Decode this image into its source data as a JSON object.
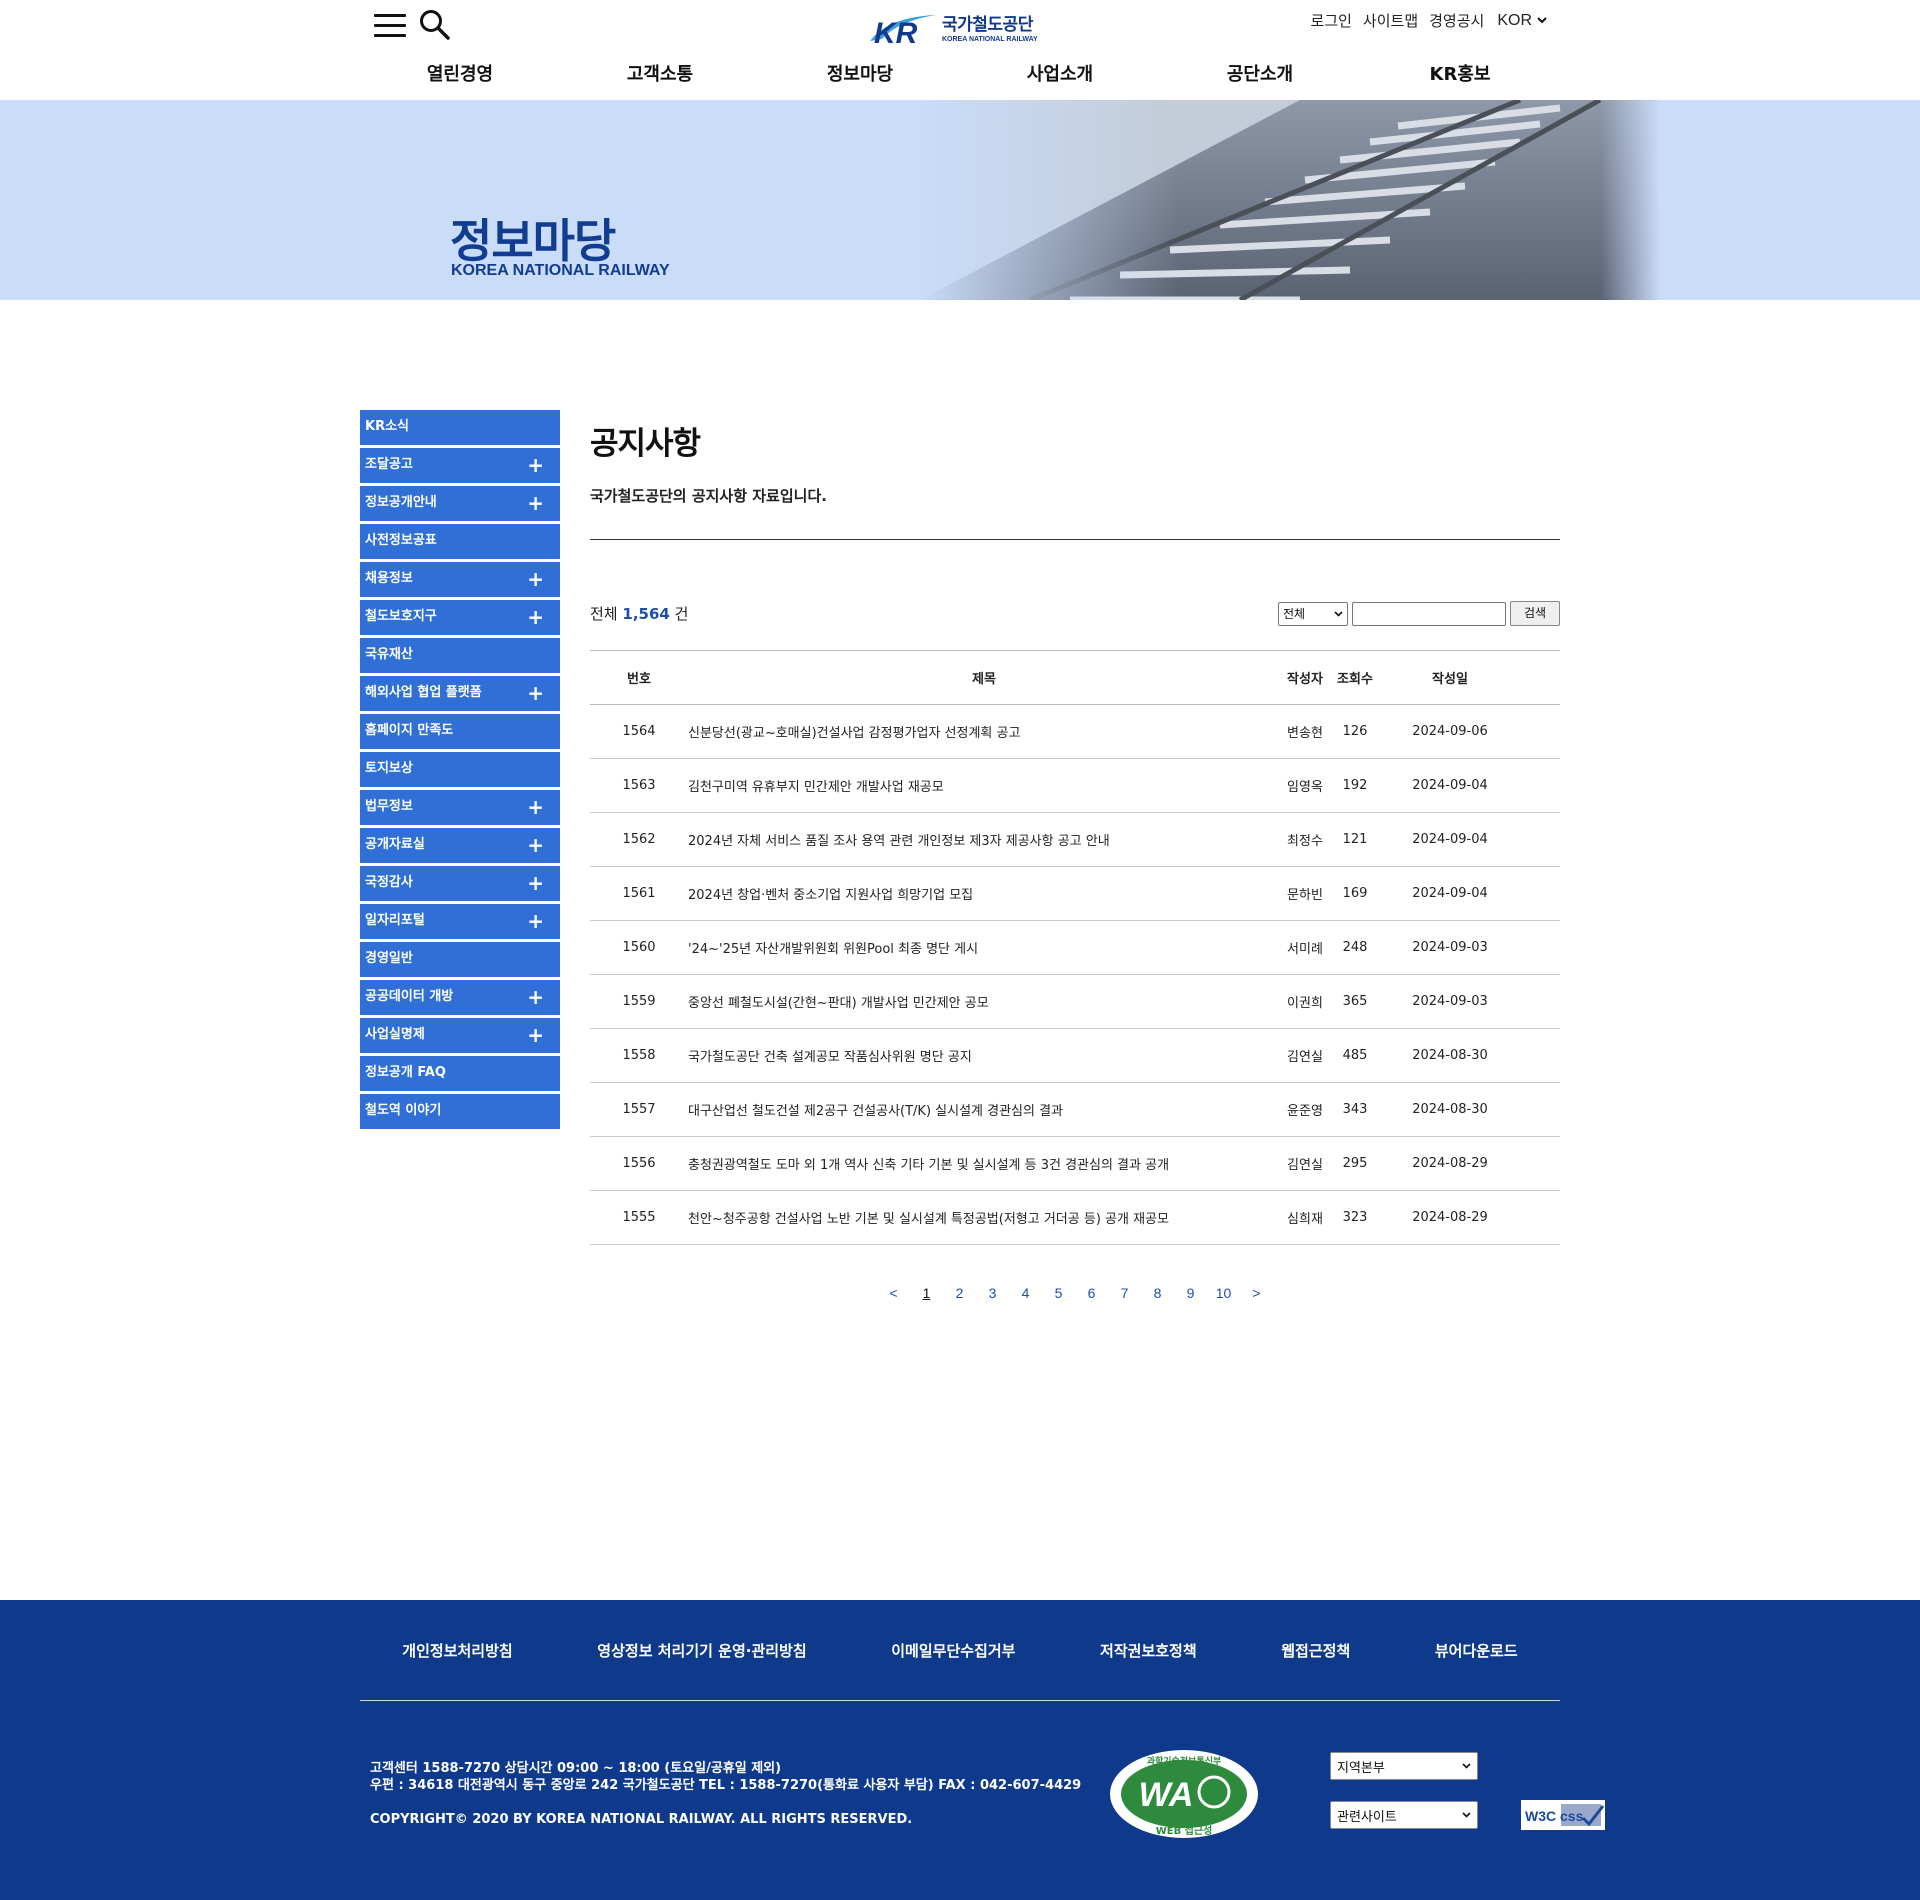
{
  "header": {
    "logo_text": "국가철도공단",
    "logo_sub": "KOREA NATIONAL RAILWAY",
    "logo_mark": "KR",
    "menu_icon": "hamburger-menu-icon",
    "search_icon": "search-icon",
    "util_links": [
      "로그인",
      "사이트맵",
      "경영공시"
    ],
    "lang": "KOR",
    "gnb": [
      "열린경영",
      "고객소통",
      "정보마당",
      "사업소개",
      "공단소개",
      "KR홍보"
    ]
  },
  "banner": {
    "title": "정보마당",
    "subtitle": "KOREA NATIONAL RAILWAY"
  },
  "sidebar": {
    "items": [
      {
        "label": "KR소식",
        "expand": ""
      },
      {
        "label": "조달공고",
        "expand": "+"
      },
      {
        "label": "정보공개안내",
        "expand": "+"
      },
      {
        "label": "사전정보공표",
        "expand": ""
      },
      {
        "label": "채용정보",
        "expand": "+"
      },
      {
        "label": "철도보호지구",
        "expand": "+"
      },
      {
        "label": "국유재산",
        "expand": ""
      },
      {
        "label": "해외사업 협업 플랫폼",
        "expand": "+"
      },
      {
        "label": "홈페이지 만족도",
        "expand": ""
      },
      {
        "label": "토지보상",
        "expand": ""
      },
      {
        "label": "법무정보",
        "expand": "+"
      },
      {
        "label": "공개자료실",
        "expand": "+"
      },
      {
        "label": "국정감사",
        "expand": "+"
      },
      {
        "label": "일자리포털",
        "expand": "+"
      },
      {
        "label": "경영일반",
        "expand": ""
      },
      {
        "label": "공공데이터 개방",
        "expand": "+"
      },
      {
        "label": "사업실명제",
        "expand": "+"
      },
      {
        "label": "정보공개 FAQ",
        "expand": ""
      },
      {
        "label": "철도역 이야기",
        "expand": ""
      }
    ]
  },
  "content": {
    "title": "공지사항",
    "description": "국가철도공단의 공지사항 자료입니다.",
    "count_prefix": "전체",
    "count": "1,564",
    "count_suffix": "건",
    "search": {
      "selected": "전체",
      "keyword": "",
      "button": "검색"
    },
    "columns": {
      "no": "번호",
      "title": "제목",
      "writer": "작성자",
      "views": "조회수",
      "date": "작성일"
    },
    "rows": [
      {
        "no": "1564",
        "title": "신분당선(광교~호매실)건설사업 감정평가업자 선정계획 공고",
        "writer": "변송현",
        "views": "126",
        "date": "2024-09-06"
      },
      {
        "no": "1563",
        "title": "김천구미역 유휴부지 민간제안 개발사업 재공모",
        "writer": "임영옥",
        "views": "192",
        "date": "2024-09-04"
      },
      {
        "no": "1562",
        "title": "2024년 자체 서비스 품질 조사 용역 관련 개인정보 제3자 제공사항 공고 안내",
        "writer": "최정수",
        "views": "121",
        "date": "2024-09-04"
      },
      {
        "no": "1561",
        "title": "2024년 창업·벤처 중소기업 지원사업 희망기업 모집",
        "writer": "문하빈",
        "views": "169",
        "date": "2024-09-04"
      },
      {
        "no": "1560",
        "title": "'24~'25년 자산개발위원회 위원Pool 최종 명단 게시",
        "writer": "서미례",
        "views": "248",
        "date": "2024-09-03"
      },
      {
        "no": "1559",
        "title": "중앙선 폐철도시설(간현~판대) 개발사업 민간제안 공모",
        "writer": "이권희",
        "views": "365",
        "date": "2024-09-03"
      },
      {
        "no": "1558",
        "title": "국가철도공단 건축 설계공모 작품심사위원 명단 공지",
        "writer": "김연실",
        "views": "485",
        "date": "2024-08-30"
      },
      {
        "no": "1557",
        "title": "대구산업선 철도건설 제2공구 건설공사(T/K) 실시설계 경관심의 결과",
        "writer": "윤준영",
        "views": "343",
        "date": "2024-08-30"
      },
      {
        "no": "1556",
        "title": "충청권광역철도 도마 외 1개 역사 신축 기타 기본 및 실시설계 등 3건 경관심의 결과 공개",
        "writer": "김연실",
        "views": "295",
        "date": "2024-08-29"
      },
      {
        "no": "1555",
        "title": "천안~청주공항 건설사업 노반 기본 및 실시설계 특정공법(저형고 거더공 등) 공개 재공모",
        "writer": "심희재",
        "views": "323",
        "date": "2024-08-29"
      }
    ],
    "pager": {
      "prev": "<",
      "pages": [
        "1",
        "2",
        "3",
        "4",
        "5",
        "6",
        "7",
        "8",
        "9",
        "10"
      ],
      "current": "1",
      "next": ">"
    }
  },
  "footer": {
    "links": [
      "개인정보처리방침",
      "영상정보 처리기기 운영·관리방침",
      "이메일무단수집거부",
      "저작권보호정책",
      "웹접근정책",
      "뷰어다운로드"
    ],
    "info_line1": "고객센터 1588-7270 상담시간 09:00 ~ 18:00 (토요일/공휴일 제외)",
    "info_line2": "우편 : 34618 대전광역시 동구 중앙로 242 국가철도공단 TEL : 1588-7270(통화료 사용자 부담) FAX : 042-607-4429",
    "copyright": "COPYRIGHT© 2020 BY KOREA NATIONAL RAILWAY. ALL RIGHTS RESERVED.",
    "wa_mark": "WA",
    "wa_ring": "과학기술정보통신부",
    "wa_label": "WEB 접근성",
    "select_region": "지역본부",
    "select_related": "관련사이트",
    "w3c_label": "W3C css"
  },
  "colors": {
    "sidebar": "#2f6fd6",
    "banner": "#c9dcf8",
    "footer": "#0f3a8c",
    "brand": "#123c91",
    "link": "#1f4fa8"
  }
}
